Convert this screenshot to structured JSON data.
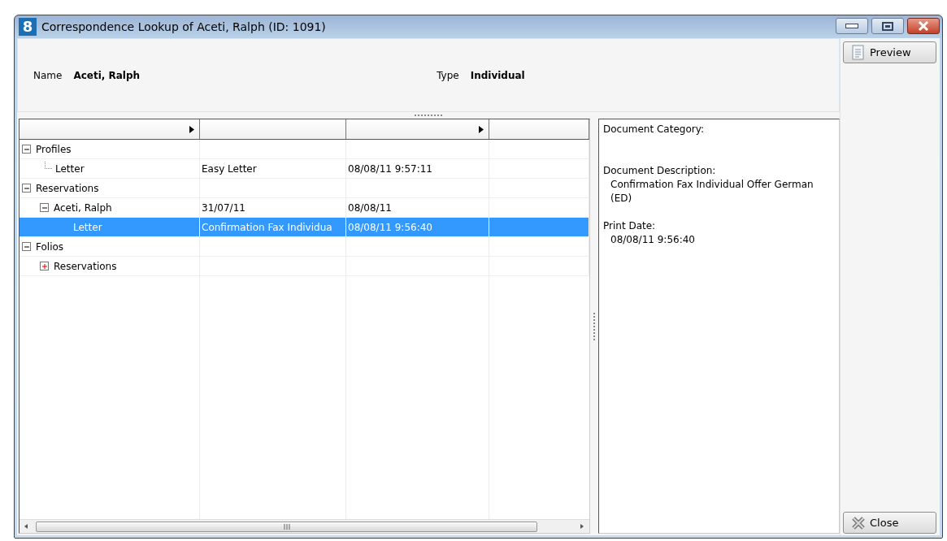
{
  "window": {
    "app_icon": "8",
    "title": "Correspondence Lookup of Aceti, Ralph (ID: 1091)"
  },
  "info": [
    {
      "label": "Name",
      "value": "Aceti, Ralph"
    },
    {
      "label": "Type",
      "value": "Individual"
    }
  ],
  "buttons": [
    {
      "kind": "top",
      "label": "Preview"
    },
    {
      "kind": "bottom",
      "label": "Close"
    }
  ],
  "grid": {
    "columns": [
      {
        "arrow": true
      },
      {
        "arrow": false
      },
      {
        "arrow": true
      },
      {
        "arrow": false
      }
    ],
    "tree": [
      {
        "label": "Profiles",
        "expanded": true,
        "selected": false,
        "children": [
          {
            "label": "Letter",
            "selected": false,
            "cells": [
              "Easy Letter",
              "08/08/11 9:57:11"
            ]
          }
        ]
      },
      {
        "label": "Reservations",
        "expanded": true,
        "selected": false,
        "children": [
          {
            "label": "Aceti, Ralph",
            "expanded": true,
            "selected": false,
            "cells": [
              "31/07/11",
              "08/08/11"
            ],
            "children": [
              {
                "label": "Letter",
                "selected": true,
                "cells": [
                  "Confirmation Fax Individua",
                  "08/08/11 9:56:40"
                ]
              }
            ]
          }
        ]
      },
      {
        "label": "Folios",
        "expanded": true,
        "selected": false,
        "children": [
          {
            "label": "Reservations",
            "expanded": false,
            "selected": false
          }
        ]
      }
    ]
  },
  "details": [
    {
      "label": "Document Category:"
    },
    {
      "label": "Document Description:",
      "value": "Confirmation Fax Individual Offer German (ED)"
    },
    {
      "label": "Print Date:",
      "value": "08/08/11 9:56:40"
    }
  ]
}
